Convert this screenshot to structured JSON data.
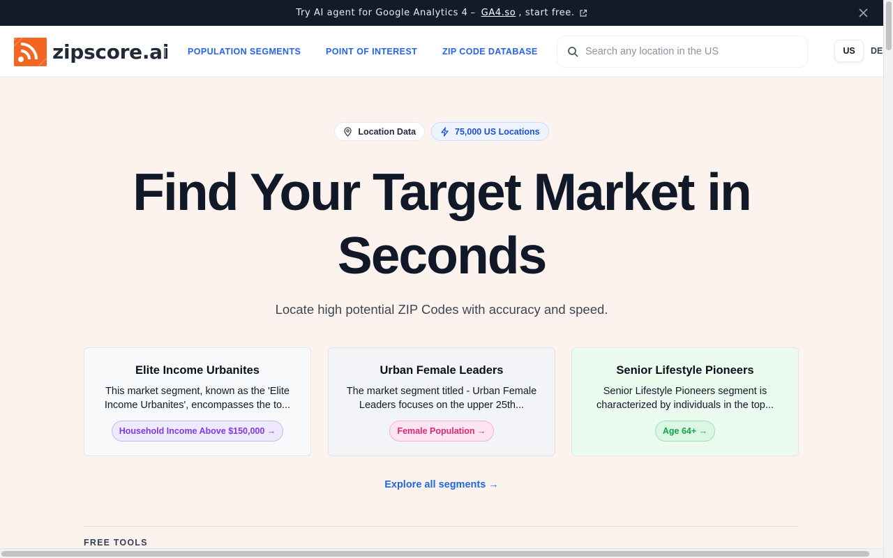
{
  "banner": {
    "text": "Try AI agent for Google Analytics 4",
    "separator": "–",
    "link_text": "GA4.so",
    "tail": ", start free."
  },
  "nav": {
    "logo_text": "zipscore.ai",
    "links": [
      "POPULATION SEGMENTS",
      "POINT OF INTEREST",
      "ZIP CODE DATABASE"
    ],
    "search_placeholder": "Search any location in the US",
    "lang_active": "US",
    "lang_other": "DE"
  },
  "hero": {
    "badge_location": "Location Data",
    "badge_count": "75,000 US Locations",
    "title_line1": "Find Your Target Market in",
    "title_line2": "Seconds",
    "subtitle": "Locate high potential ZIP Codes with accuracy and speed."
  },
  "segments": [
    {
      "title": "Elite Income Urbanites",
      "desc": "This market segment, known as the 'Elite Income Urbanites', encompasses the to...",
      "tag": "Household Income Above $150,000 →"
    },
    {
      "title": "Urban Female Leaders",
      "desc": "The market segment titled - Urban Female Leaders focuses on the upper 25th...",
      "tag": "Female Population →"
    },
    {
      "title": "Senior Lifestyle Pioneers",
      "desc": "Senior Lifestyle Pioneers segment is characterized by individuals in the top...",
      "tag": "Age 64+ →"
    }
  ],
  "explore_text": "Explore all segments →",
  "free_tools_heading": "FREE TOOLS",
  "colors": {
    "accent": "#2563eb",
    "logo_orange": "#f26522",
    "banner_bg": "#131b2b",
    "page_bg": "#fcf3ef"
  }
}
